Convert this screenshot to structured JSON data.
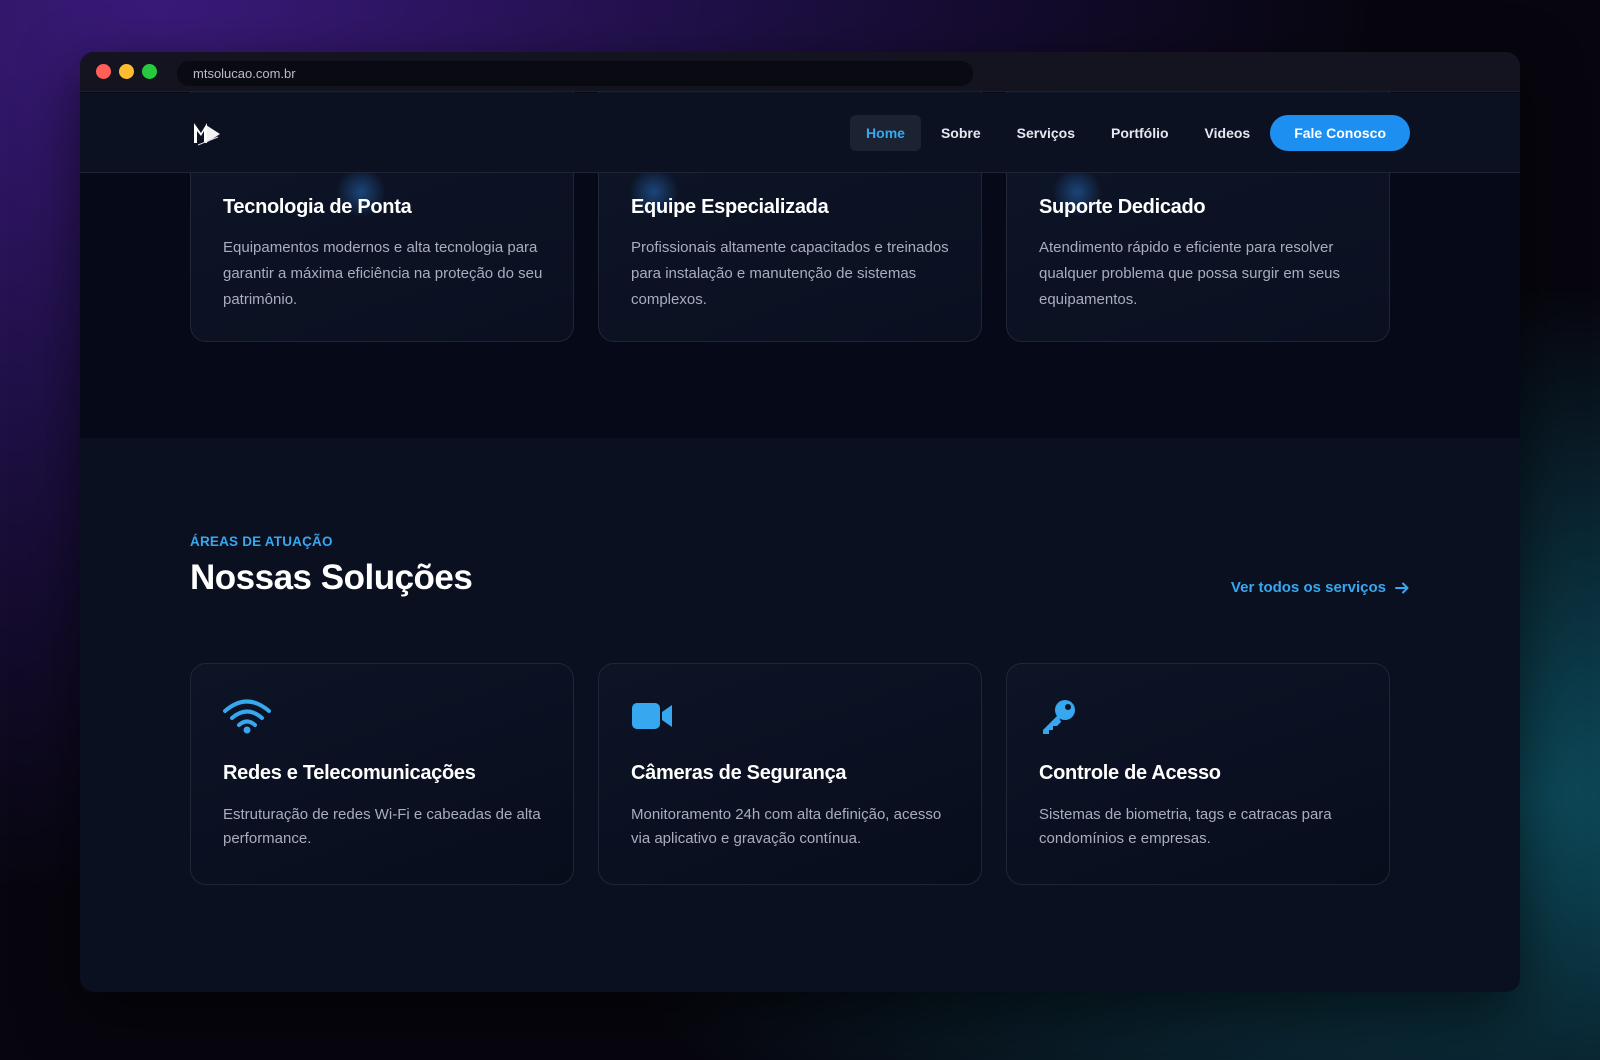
{
  "browser": {
    "url": "mtsolucao.com.br",
    "traffic_lights": [
      "#ff5f57",
      "#febc2e",
      "#28c840"
    ]
  },
  "nav": {
    "logo_text": "MT",
    "items": [
      {
        "label": "Home",
        "active": true
      },
      {
        "label": "Sobre",
        "active": false
      },
      {
        "label": "Serviços",
        "active": false
      },
      {
        "label": "Portfólio",
        "active": false
      },
      {
        "label": "Videos",
        "active": false
      }
    ],
    "cta_label": "Fale Conosco"
  },
  "features": [
    {
      "title": "Tecnologia de Ponta",
      "description": "Equipamentos modernos e alta tecnologia para garantir a máxima eficiência na proteção do seu patrimônio."
    },
    {
      "title": "Equipe Especializada",
      "description": "Profissionais altamente capacitados e treinados para instalação e manutenção de sistemas complexos."
    },
    {
      "title": "Suporte Dedicado",
      "description": "Atendimento rápido e eficiente para resolver qualquer problema que possa surgir em seus equipamentos."
    }
  ],
  "solutions": {
    "eyebrow": "ÁREAS DE ATUAÇÃO",
    "title": "Nossas Soluções",
    "see_all_label": "Ver todos os serviços",
    "cards": [
      {
        "icon": "wifi-icon",
        "title": "Redes e Telecomunicações",
        "description": "Estruturação de redes Wi-Fi e cabeadas de alta performance."
      },
      {
        "icon": "video-camera-icon",
        "title": "Câmeras de Segurança",
        "description": "Monitoramento 24h com alta definição, acesso via aplicativo e gravação contínua."
      },
      {
        "icon": "key-icon",
        "title": "Controle de Acesso",
        "description": "Sistemas de biometria, tags e catracas para condomínios e empresas."
      }
    ]
  },
  "colors": {
    "accent": "#37a7f0",
    "cta": "#1d8ff0",
    "background": "#0a1020"
  }
}
